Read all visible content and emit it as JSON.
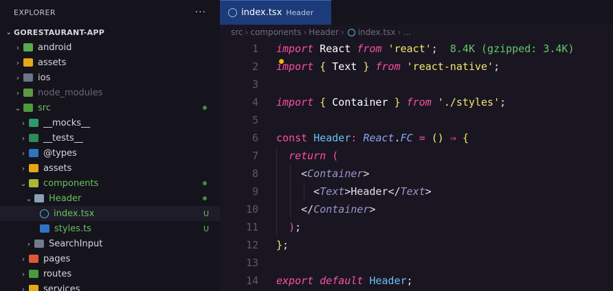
{
  "sidebar": {
    "title": "EXPLORER",
    "more": "···",
    "project": "GORESTAURANT-APP",
    "items": [
      {
        "label": "android",
        "status": ""
      },
      {
        "label": "assets",
        "status": ""
      },
      {
        "label": "ios",
        "status": ""
      },
      {
        "label": "node_modules",
        "status": ""
      },
      {
        "label": "src",
        "status": ""
      },
      {
        "label": "__mocks__",
        "status": ""
      },
      {
        "label": "__tests__",
        "status": ""
      },
      {
        "label": "@types",
        "status": ""
      },
      {
        "label": "assets",
        "status": ""
      },
      {
        "label": "components",
        "status": ""
      },
      {
        "label": "Header",
        "status": ""
      },
      {
        "label": "index.tsx",
        "status": "U"
      },
      {
        "label": "styles.ts",
        "status": "U"
      },
      {
        "label": "SearchInput",
        "status": ""
      },
      {
        "label": "pages",
        "status": ""
      },
      {
        "label": "routes",
        "status": ""
      },
      {
        "label": "services",
        "status": ""
      }
    ]
  },
  "editor": {
    "tab": {
      "name": "index.tsx",
      "description": "Header"
    },
    "breadcrumb": [
      "src",
      "components",
      "Header",
      "index.tsx",
      "..."
    ],
    "lines": [
      {
        "n": "1"
      },
      {
        "n": "2"
      },
      {
        "n": "3"
      },
      {
        "n": "4"
      },
      {
        "n": "5"
      },
      {
        "n": "6"
      },
      {
        "n": "7"
      },
      {
        "n": "8"
      },
      {
        "n": "9"
      },
      {
        "n": "10"
      },
      {
        "n": "11"
      },
      {
        "n": "12"
      },
      {
        "n": "13"
      },
      {
        "n": "14"
      }
    ],
    "code": {
      "import": "import",
      "from": "from",
      "react_id": "React",
      "react_str": "'react'",
      "size_hint": "8.4K (gzipped: 3.4K)",
      "text_id": "Text",
      "rn_str": "'react-native'",
      "container_id": "Container",
      "styles_str": "'./styles'",
      "const": "const",
      "header_id": "Header",
      "react_ns": "React",
      "fc": "FC",
      "return": "return",
      "header_text": "Header",
      "export": "export",
      "default": "default"
    }
  },
  "colors": {
    "accent": "#1d3b78",
    "keyword": "#ff4fa3",
    "string": "#f7e66b",
    "untracked": "#67c45c"
  },
  "icons": {
    "react_file": "react-icon",
    "ts_file": "typescript-icon",
    "folder": "folder-icon"
  }
}
